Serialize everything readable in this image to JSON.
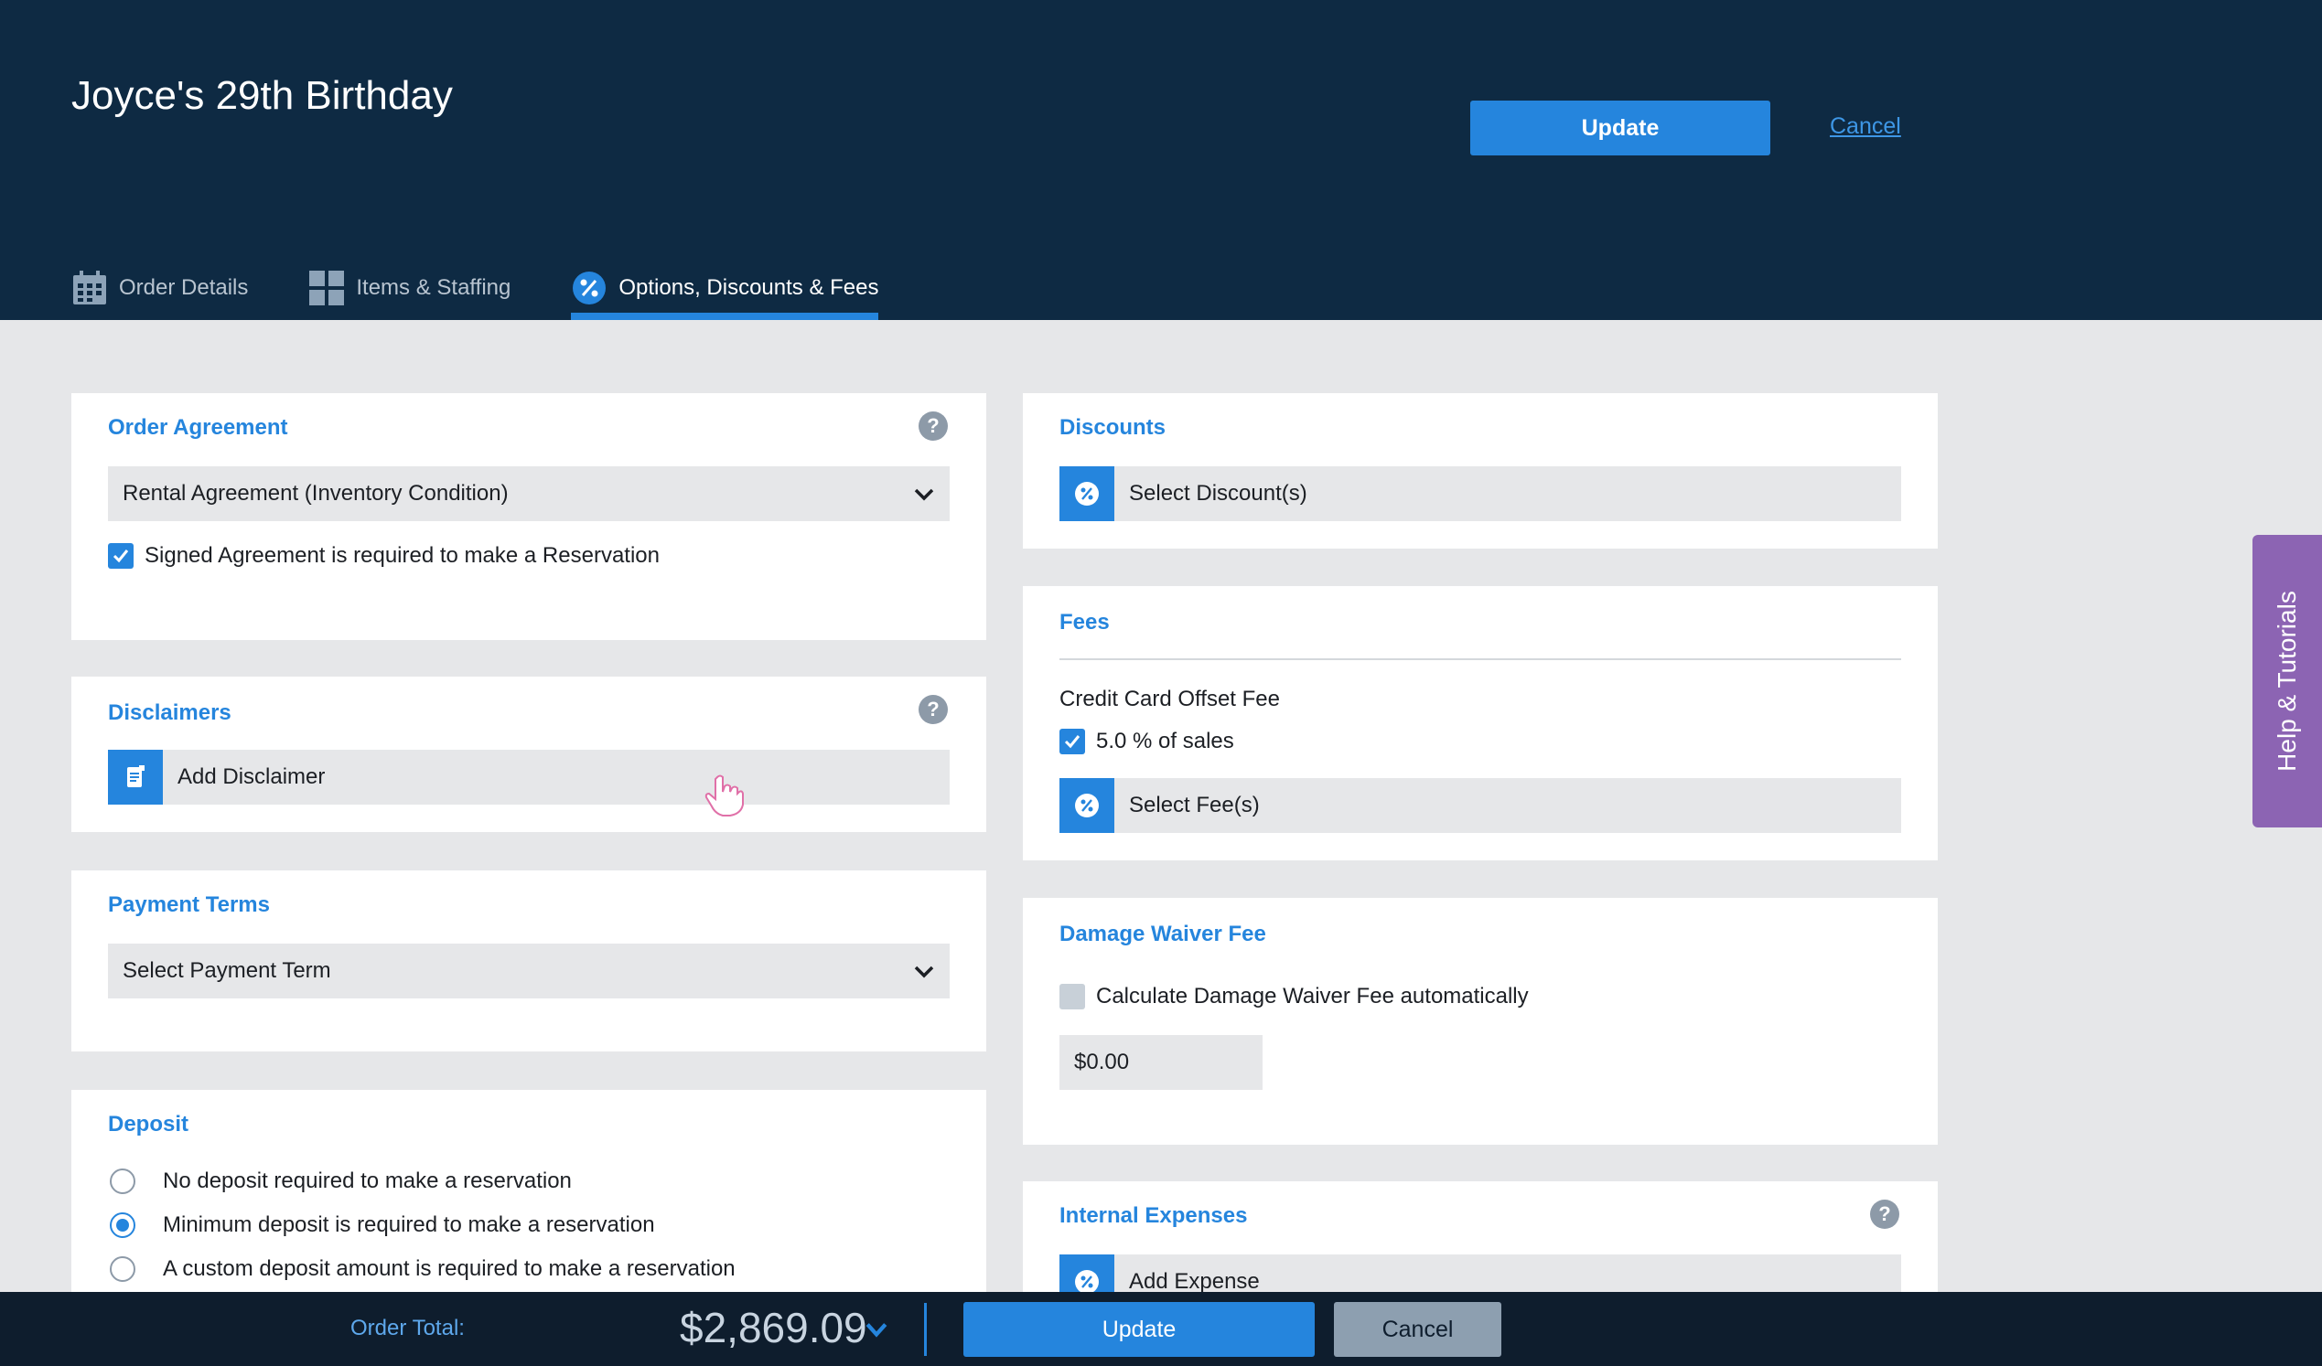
{
  "header": {
    "title": "Joyce's 29th Birthday",
    "update_label": "Update",
    "cancel_label": "Cancel"
  },
  "tabs": [
    {
      "label": "Order Details",
      "icon": "calendar-icon",
      "active": false
    },
    {
      "label": "Items & Staffing",
      "icon": "grid-icon",
      "active": false
    },
    {
      "label": "Options, Discounts & Fees",
      "icon": "percent-badge-icon",
      "active": true
    }
  ],
  "order_agreement": {
    "title": "Order Agreement",
    "selected": "Rental Agreement (Inventory Condition)",
    "checkbox_label": "Signed Agreement is required to make a Reservation",
    "checked": true
  },
  "disclaimers": {
    "title": "Disclaimers",
    "add_label": "Add Disclaimer"
  },
  "payment_terms": {
    "title": "Payment Terms",
    "placeholder": "Select Payment Term"
  },
  "deposit": {
    "title": "Deposit",
    "options": [
      {
        "label": "No deposit required to make a reservation",
        "selected": false
      },
      {
        "label": "Minimum deposit is required to make a reservation",
        "selected": true
      },
      {
        "label": "A custom deposit amount is required to make a reservation",
        "selected": false
      }
    ]
  },
  "discounts": {
    "title": "Discounts",
    "select_label": "Select Discount(s)"
  },
  "fees": {
    "title": "Fees",
    "fee_name": "Credit Card Offset Fee",
    "fee_option": "5.0 % of sales",
    "fee_checked": true,
    "select_label": "Select Fee(s)"
  },
  "damage_waiver": {
    "title": "Damage Waiver Fee",
    "checkbox_label": "Calculate Damage Waiver Fee automatically",
    "checked": false,
    "amount": "$0.00"
  },
  "internal_expenses": {
    "title": "Internal Expenses",
    "add_label": "Add Expense"
  },
  "help_tab": {
    "label": "Help & Tutorials"
  },
  "footer": {
    "total_label": "Order Total:",
    "total_value": "$2,869.09",
    "update_label": "Update",
    "cancel_label": "Cancel"
  },
  "colors": {
    "header_bg": "#0e2a43",
    "accent": "#2585dd",
    "help_tab": "#8c64b3",
    "footer_bg": "#0e1d2d"
  }
}
